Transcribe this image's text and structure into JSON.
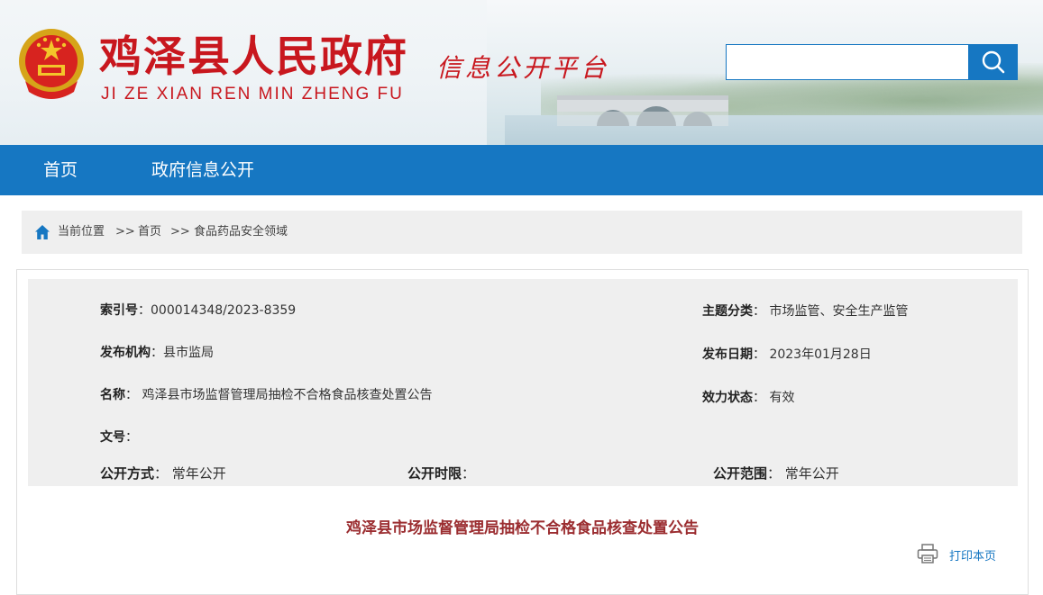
{
  "header": {
    "site_title": "鸡泽县人民政府",
    "site_pinyin": "JI ZE XIAN REN MIN ZHENG FU",
    "platform_title": "信息公开平台",
    "emblem_icon": "national-emblem-icon",
    "search": {
      "placeholder": "",
      "value": "",
      "button_icon": "search-icon"
    }
  },
  "nav": {
    "items": [
      {
        "label": "首页"
      },
      {
        "label": "政府信息公开"
      }
    ]
  },
  "breadcrumb": {
    "icon": "home-icon",
    "current_label": "当前位置",
    "sep1": ">>",
    "home": "首页",
    "sep2": ">>",
    "section": "食品药品安全领域"
  },
  "meta": {
    "index_label": "索引号",
    "index_value": "000014348/2023-8359",
    "topic_label": "主题分类",
    "topic_value": "市场监管、安全生产监管",
    "publisher_label": "发布机构",
    "publisher_value": "县市监局",
    "date_label": "发布日期",
    "date_value": "2023年01月28日",
    "name_label": "名称",
    "name_value": "鸡泽县市场监督管理局抽检不合格食品核查处置公告",
    "status_label": "效力状态",
    "status_value": "有效",
    "doc_label": "文号",
    "doc_value": "",
    "method_label": "公开方式",
    "method_value": "常年公开",
    "limit_label": "公开时限",
    "limit_value": "",
    "scope_label": "公开范围",
    "scope_value": "常年公开"
  },
  "article": {
    "title": "鸡泽县市场监督管理局抽检不合格食品核查处置公告",
    "print_label": "打印本页",
    "print_icon": "printer-icon"
  },
  "colors": {
    "brand_red": "#c8171e",
    "nav_blue": "#1677c2",
    "title_maroon": "#9b2d30",
    "panel_gray": "#efefef"
  }
}
